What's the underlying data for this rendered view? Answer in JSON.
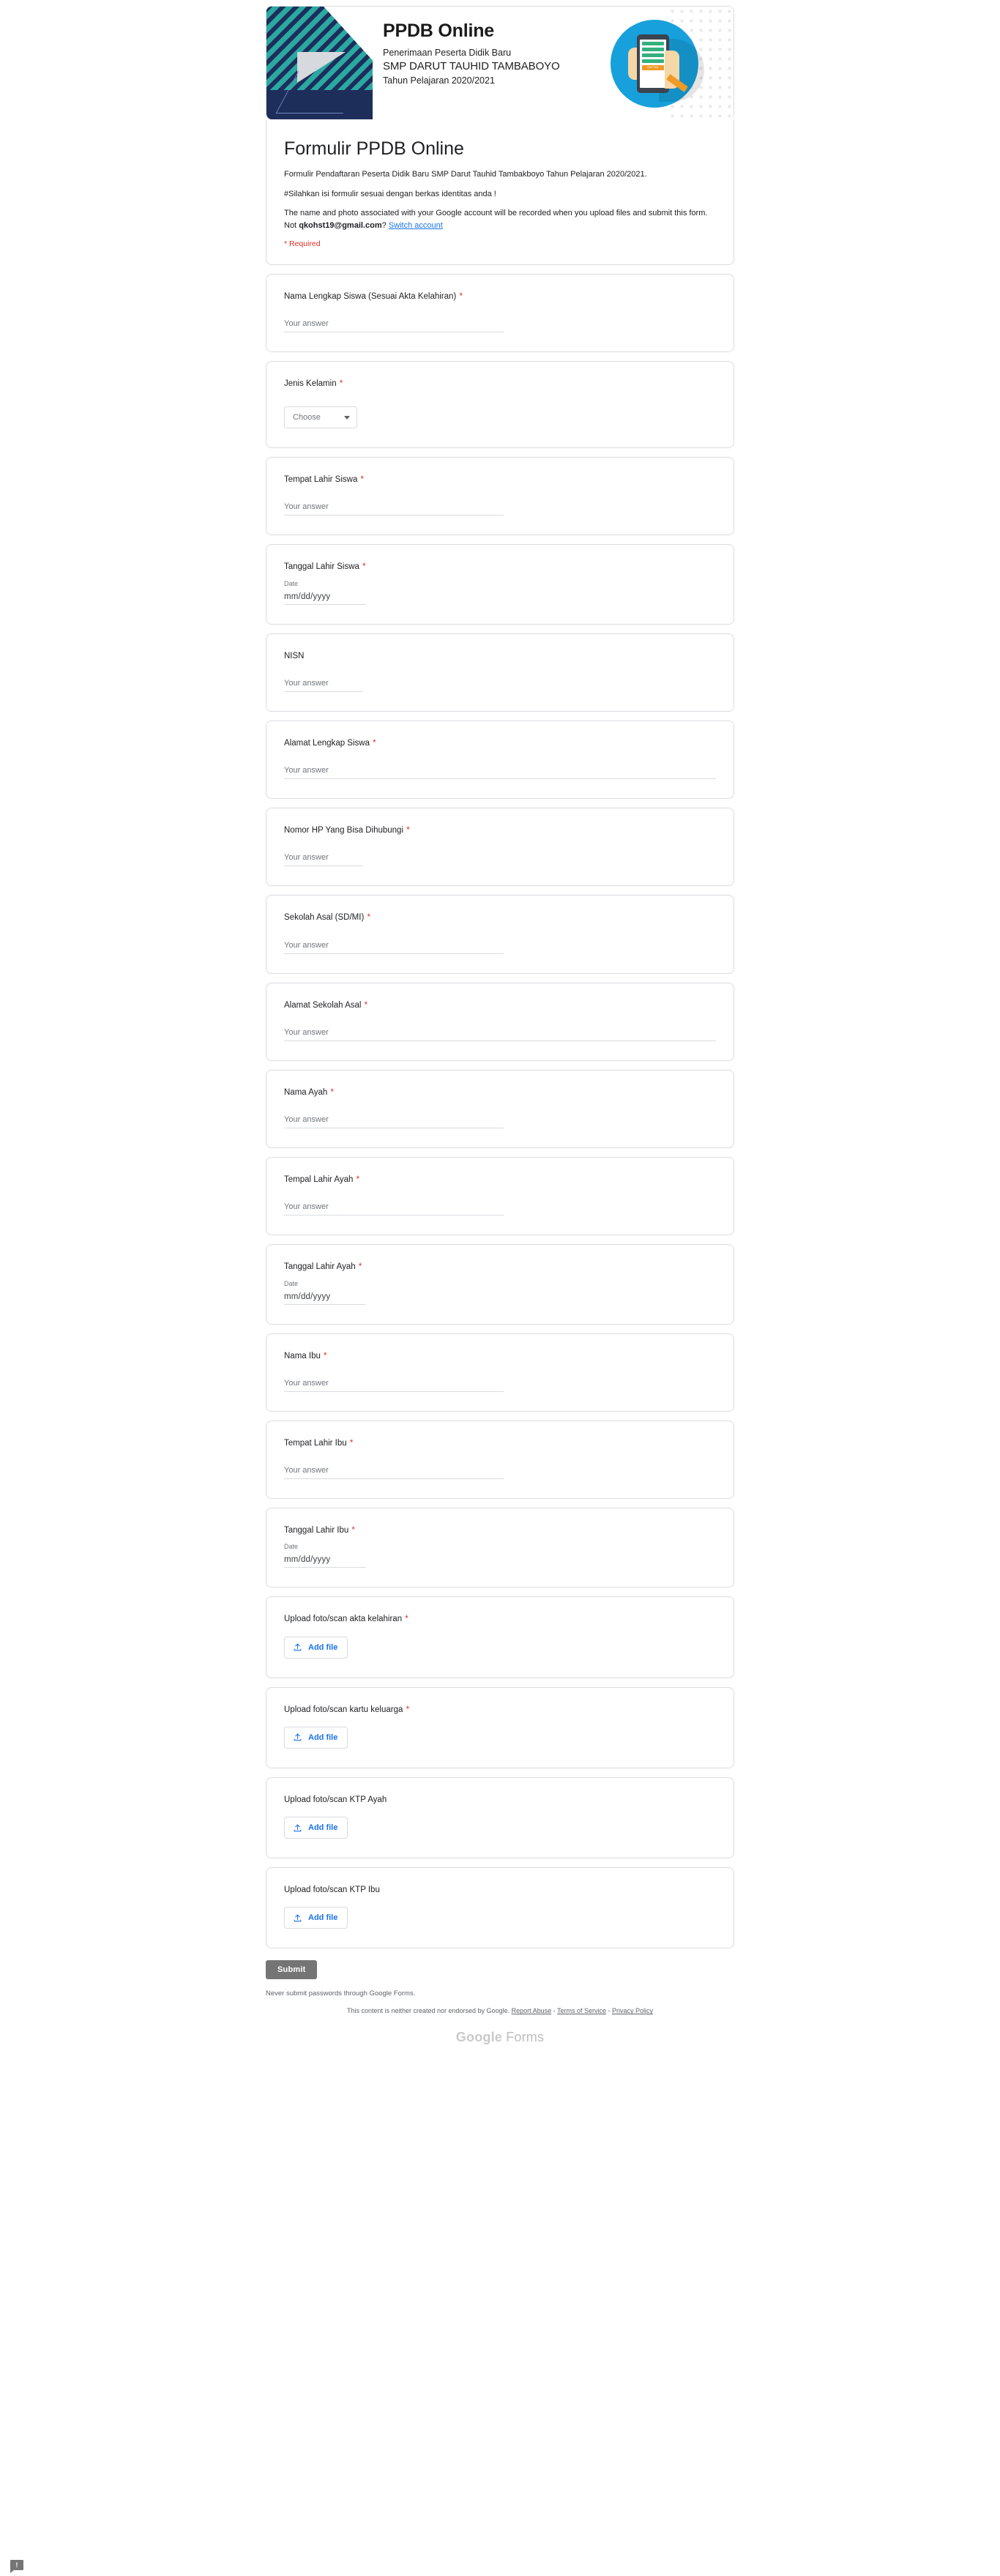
{
  "banner": {
    "title": "PPDB Online",
    "line1": "Penerimaan Peserta Didik Baru",
    "line2": "SMP DARUT TAUHID TAMBABOYO",
    "line3": "Tahun Pelajaran 2020/2021",
    "icon_button_label": "DAFTAR",
    "icon_name": "hand-holding-phone-registration-icon"
  },
  "header": {
    "title": "Formulir PPDB Online",
    "description_1": "Formulir Pendaftaran Peserta Didik Baru SMP Darut Tauhid Tambakboyo Tahun Pelajaran 2020/2021.",
    "description_2": "#Silahkan isi formulir sesuai dengan berkas identitas anda !",
    "account_notice_prefix": "The name and photo associated with your Google account will be recorded when you upload files and submit this form. Not ",
    "account_email": "qkohst19@gmail.com",
    "account_notice_suffix": "? ",
    "switch_account_label": "Switch account",
    "required_note": "* Required"
  },
  "placeholders": {
    "your_answer": "Your answer",
    "date_value": "mm/dd/yyyy",
    "date_label": "Date",
    "choose": "Choose"
  },
  "questions": [
    {
      "label": "Nama Lengkap Siswa (Sesuai Akta Kelahiran)",
      "required": true,
      "type": "short_text",
      "width": "w-long"
    },
    {
      "label": "Jenis Kelamin",
      "required": true,
      "type": "dropdown",
      "width": ""
    },
    {
      "label": "Tempat Lahir Siswa",
      "required": true,
      "type": "short_text",
      "width": "w-long"
    },
    {
      "label": "Tanggal Lahir Siswa",
      "required": true,
      "type": "date",
      "width": ""
    },
    {
      "label": "NISN",
      "required": false,
      "type": "short_text",
      "width": "w-short"
    },
    {
      "label": "Alamat Lengkap Siswa",
      "required": true,
      "type": "short_text",
      "width": "w-full"
    },
    {
      "label": "Nomor HP Yang Bisa Dihubungi",
      "required": true,
      "type": "short_text",
      "width": "w-short"
    },
    {
      "label": "Sekolah Asal (SD/MI)",
      "required": true,
      "type": "short_text",
      "width": "w-long"
    },
    {
      "label": "Alamat Sekolah Asal",
      "required": true,
      "type": "short_text",
      "width": "w-full"
    },
    {
      "label": "Nama Ayah",
      "required": true,
      "type": "short_text",
      "width": "w-long"
    },
    {
      "label": "Tempal Lahir Ayah",
      "required": true,
      "type": "short_text",
      "width": "w-long"
    },
    {
      "label": "Tanggal Lahir Ayah",
      "required": true,
      "type": "date",
      "width": ""
    },
    {
      "label": "Nama Ibu",
      "required": true,
      "type": "short_text",
      "width": "w-long"
    },
    {
      "label": "Tempat Lahir Ibu",
      "required": true,
      "type": "short_text",
      "width": "w-long"
    },
    {
      "label": "Tanggal Lahir Ibu",
      "required": true,
      "type": "date",
      "width": ""
    },
    {
      "label": "Upload foto/scan akta kelahiran",
      "required": true,
      "type": "file",
      "width": ""
    },
    {
      "label": "Upload foto/scan kartu keluarga",
      "required": true,
      "type": "file",
      "width": ""
    },
    {
      "label": "Upload foto/scan KTP Ayah",
      "required": false,
      "type": "file",
      "width": ""
    },
    {
      "label": "Upload foto/scan KTP Ibu",
      "required": false,
      "type": "file",
      "width": ""
    }
  ],
  "footer": {
    "submit_label": "Submit",
    "never_note": "Never submit passwords through Google Forms.",
    "legal_prefix": "This content is neither created nor endorsed by Google. ",
    "report_abuse": "Report Abuse",
    "sep1": " - ",
    "terms": "Terms of Service",
    "sep2": " - ",
    "privacy": "Privacy Policy",
    "brand_google": "Google",
    "brand_forms": " Forms"
  },
  "colors": {
    "accent_blue": "#1a73e8",
    "required_red": "#d93025",
    "submit_grey": "#757575",
    "banner_navy": "#1d2e5b",
    "banner_teal": "#2aa9a2",
    "icon_circle_blue": "#17a0db"
  }
}
